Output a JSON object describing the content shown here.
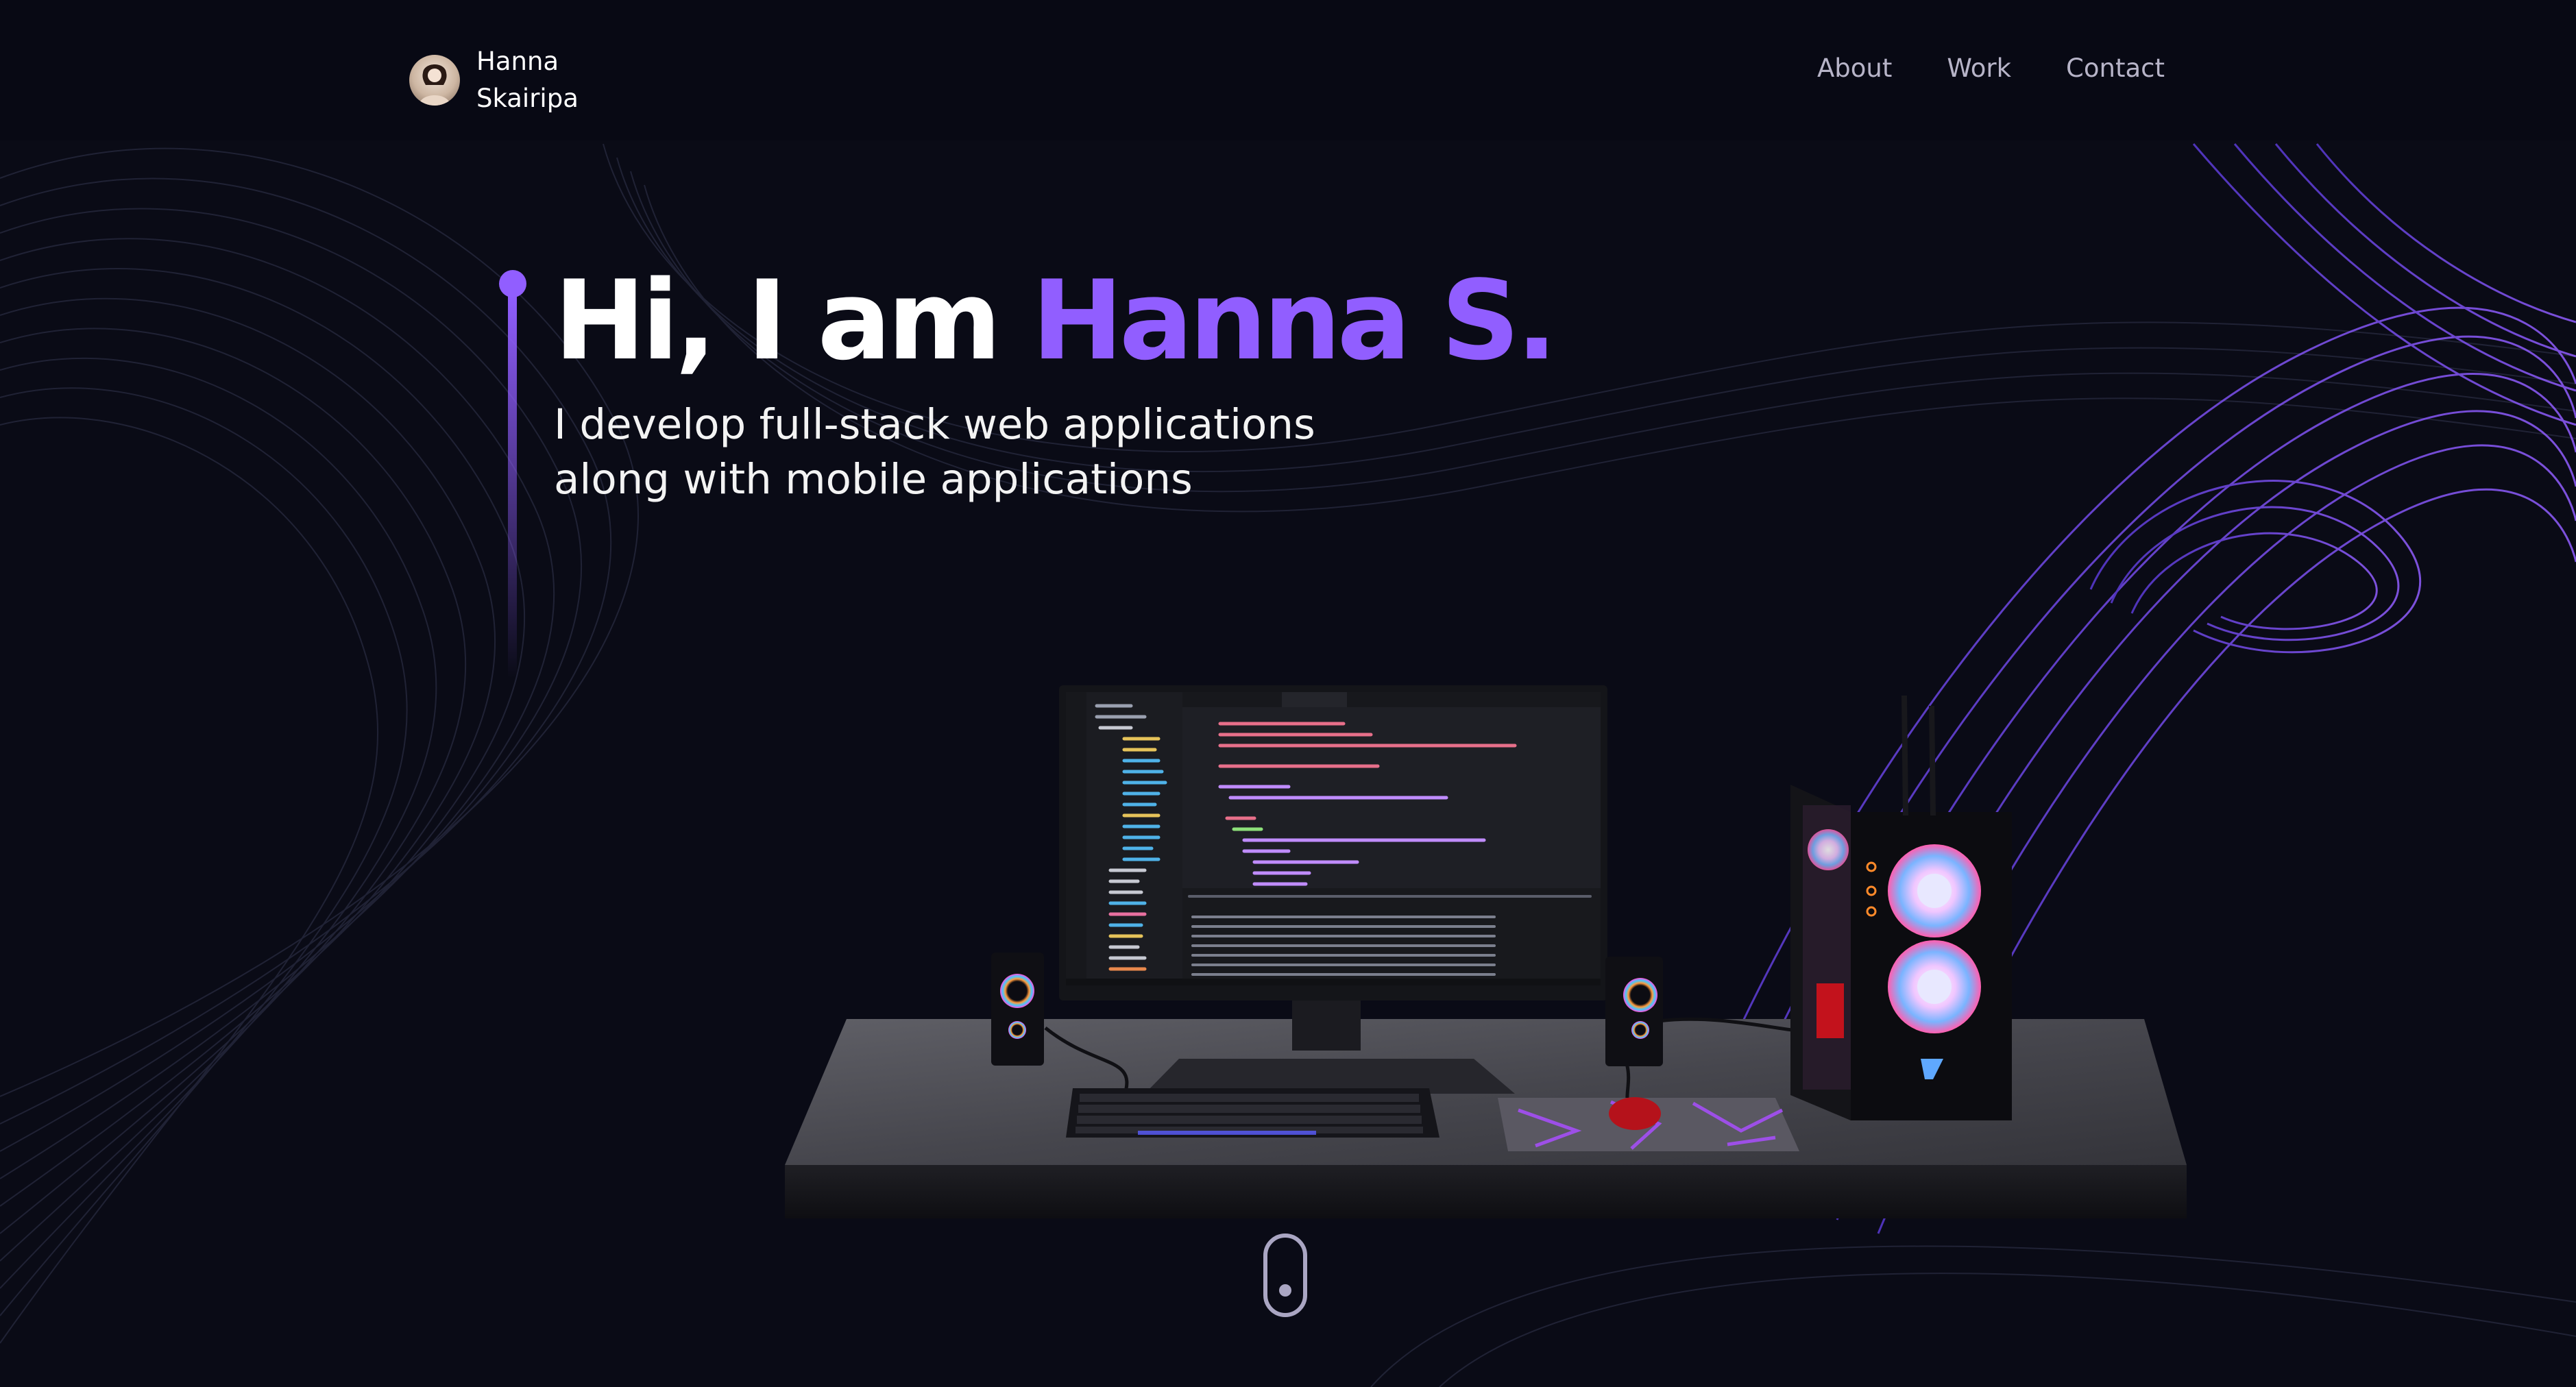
{
  "brand": {
    "first_name": "Hanna",
    "last_name": "Skairipa"
  },
  "nav": {
    "items": [
      "About",
      "Work",
      "Contact"
    ]
  },
  "hero": {
    "greeting": "Hi, I am ",
    "name": "Hanna S.",
    "subtitle_line1": "I develop full-stack web applications",
    "subtitle_line2": "along with mobile applications"
  },
  "colors": {
    "background": "#0a0b16",
    "accent": "#915eff",
    "nav_text": "#b7b4c8"
  },
  "icons": {
    "scroll": "mouse-scroll-icon",
    "avatar": "avatar"
  }
}
